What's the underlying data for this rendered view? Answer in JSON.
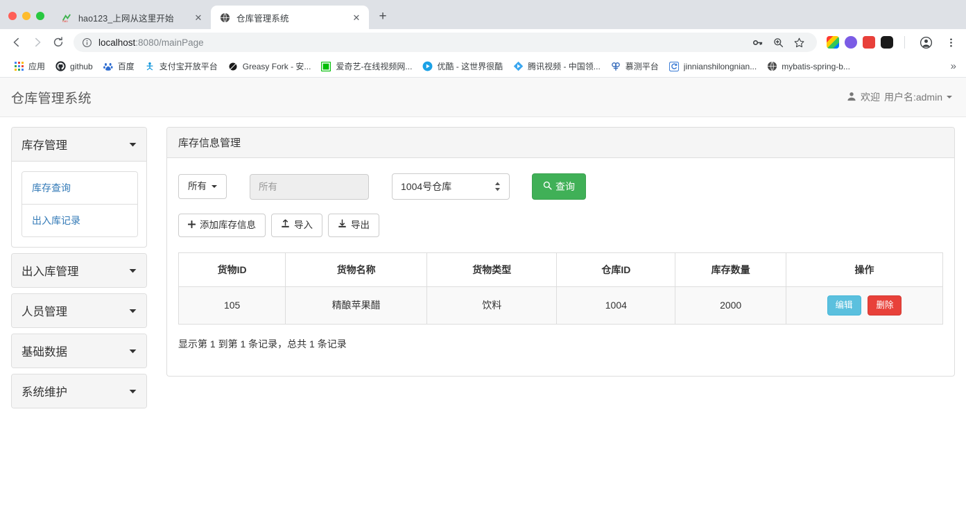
{
  "browser": {
    "tabs": [
      {
        "title": "hao123_上网从这里开始",
        "favicon": "hao123-icon",
        "active": false
      },
      {
        "title": "仓库管理系统",
        "favicon": "globe-icon",
        "active": true
      }
    ],
    "new_tab_label": "+",
    "close_label": "✕",
    "nav": {
      "back": "←",
      "forward": "→",
      "reload": "⟳"
    },
    "omnibox": {
      "url_host": "localhost",
      "url_rest": ":8080/mainPage",
      "info_icon": "info-circle-icon",
      "key_icon": "key-icon",
      "zoom_icon": "zoom-in-icon",
      "star_icon": "star-icon",
      "profile_icon": "profile-avatar-icon",
      "menu_icon": "kebab-menu-icon"
    },
    "extensions": [
      "extension-colorful-icon",
      "extension-purple-r-icon",
      "extension-fe-icon",
      "extension-black-icon"
    ],
    "bookmarks": [
      {
        "label": "应用",
        "icon": "apps-grid-icon"
      },
      {
        "label": "github",
        "icon": "github-icon"
      },
      {
        "label": "百度",
        "icon": "baidu-icon"
      },
      {
        "label": "支付宝开放平台",
        "icon": "alipay-icon"
      },
      {
        "label": "Greasy Fork - 安...",
        "icon": "greasyfork-icon"
      },
      {
        "label": "爱奇艺-在线视频网...",
        "icon": "iqiyi-icon"
      },
      {
        "label": "优酷 - 这世界很酷",
        "icon": "youku-icon"
      },
      {
        "label": "腾讯视频 - 中国领...",
        "icon": "tencent-video-icon"
      },
      {
        "label": "慕测平台",
        "icon": "mooctest-icon"
      },
      {
        "label": "jinnianshilongnian...",
        "icon": "generic-blue-icon"
      },
      {
        "label": "mybatis-spring-b...",
        "icon": "globe-icon"
      }
    ],
    "bookmarks_overflow": "»"
  },
  "app": {
    "brand": "仓库管理系统",
    "user": {
      "icon": "user-icon",
      "greeting": "欢迎",
      "name_label": "用户名:admin"
    },
    "sidebar": {
      "groups": [
        {
          "title": "库存管理",
          "expanded": true,
          "items": [
            {
              "label": "库存查询"
            },
            {
              "label": "出入库记录"
            }
          ]
        },
        {
          "title": "出入库管理",
          "expanded": false,
          "items": []
        },
        {
          "title": "人员管理",
          "expanded": false,
          "items": []
        },
        {
          "title": "基础数据",
          "expanded": false,
          "items": []
        },
        {
          "title": "系统维护",
          "expanded": false,
          "items": []
        }
      ]
    },
    "panel": {
      "title": "库存信息管理",
      "filters": {
        "category_dropdown": {
          "label": "所有",
          "icon": "caret-down-icon"
        },
        "keyword_input": {
          "value": "",
          "placeholder": "所有"
        },
        "warehouse_select": {
          "value": "1004号仓库",
          "icon": "spinner-updown-icon"
        },
        "search_button": {
          "label": "查询",
          "icon": "search-icon",
          "color": "#40b057"
        }
      },
      "actions": [
        {
          "label": "添加库存信息",
          "icon": "plus-icon",
          "name": "add-inventory-button"
        },
        {
          "label": "导入",
          "icon": "import-icon",
          "name": "import-button"
        },
        {
          "label": "导出",
          "icon": "export-icon",
          "name": "export-button"
        }
      ],
      "table": {
        "columns": [
          "货物ID",
          "货物名称",
          "货物类型",
          "仓库ID",
          "库存数量",
          "操作"
        ],
        "rows": [
          {
            "goods_id": "105",
            "goods_name": "精酿苹果醋",
            "goods_type": "饮料",
            "warehouse_id": "1004",
            "quantity": "2000",
            "edit_label": "编辑",
            "delete_label": "删除"
          }
        ],
        "info": "显示第 1 到第 1 条记录，总共 1 条记录",
        "edit_color": "#5bc0de",
        "delete_color": "#e8413a"
      }
    }
  }
}
